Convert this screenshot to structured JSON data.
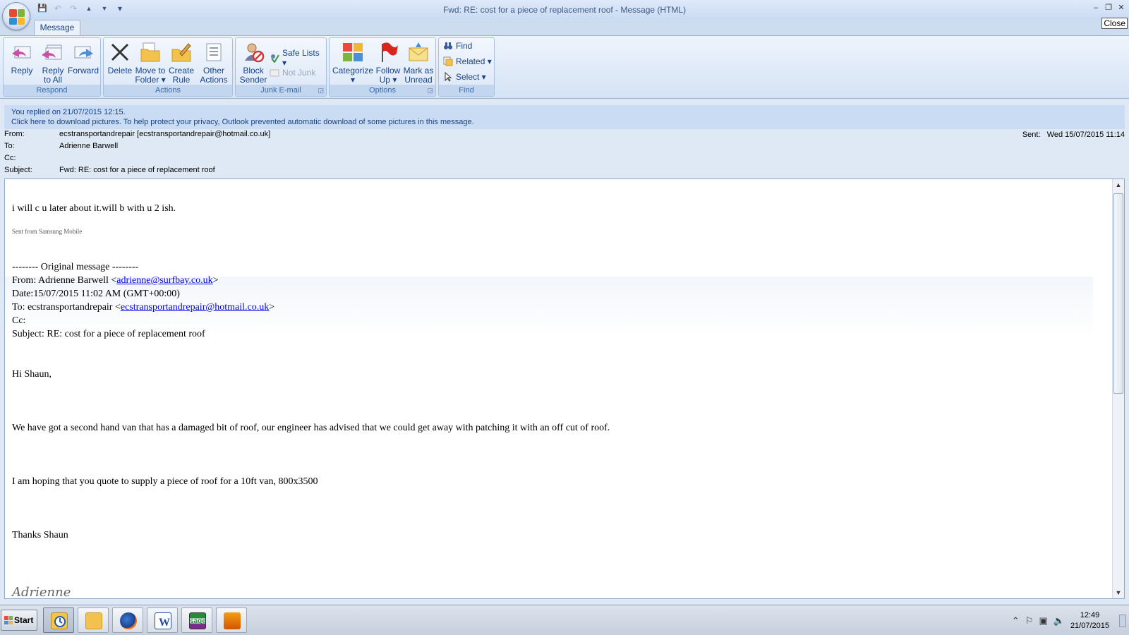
{
  "window": {
    "title": "Fwd: RE: cost for a piece of replacement roof - Message (HTML)",
    "close_tooltip": "Close",
    "controls": {
      "minimize": "–",
      "restore": "❐",
      "close": "✕"
    }
  },
  "qat": {
    "save": "💾",
    "undo": "↶",
    "redo": "↷",
    "up": "▲",
    "down": "▼",
    "customize": "▾"
  },
  "tabs": [
    {
      "label": "Message"
    }
  ],
  "ribbon": {
    "respond": {
      "label": "Respond",
      "reply": "Reply",
      "reply_all_1": "Reply",
      "reply_all_2": "to All",
      "forward": "Forward"
    },
    "actions": {
      "label": "Actions",
      "delete": "Delete",
      "move_1": "Move to",
      "move_2": "Folder ▾",
      "rule_1": "Create",
      "rule_2": "Rule",
      "other_1": "Other",
      "other_2": "Actions ▾"
    },
    "junk": {
      "label": "Junk E-mail",
      "block_1": "Block",
      "block_2": "Sender",
      "safe_lists": "Safe Lists ▾",
      "not_junk": "Not Junk"
    },
    "options": {
      "label": "Options",
      "categorize": "Categorize",
      "categorize_2": "▾",
      "follow_1": "Follow",
      "follow_2": "Up ▾",
      "mark_1": "Mark as",
      "mark_2": "Unread"
    },
    "find": {
      "label": "Find",
      "find": "Find",
      "related": "Related ▾",
      "select": "Select ▾"
    }
  },
  "infobar": {
    "line1": "You replied on 21/07/2015 12:15.",
    "line2": "Click here to download pictures. To help protect your privacy, Outlook prevented automatic download of some pictures in this message."
  },
  "header": {
    "from_label": "From:",
    "from_value": "ecstransportandrepair [ecstransportandrepair@hotmail.co.uk]",
    "to_label": "To:",
    "to_value": "Adrienne Barwell",
    "cc_label": "Cc:",
    "cc_value": "",
    "subject_label": "Subject:",
    "subject_value": "Fwd: RE: cost for a piece of replacement roof",
    "sent_label": "Sent:",
    "sent_value": "Wed 15/07/2015 11:14"
  },
  "body": {
    "line1": "i will c u later about it.will b with u 2 ish.",
    "sent_from": "Sent from Samsung Mobile",
    "original": "-------- Original message --------",
    "from_prefix": "From: Adrienne Barwell <",
    "from_email": "adrienne@surfbay.co.uk",
    "from_suffix": ">",
    "date": "Date:15/07/2015 11:02 AM (GMT+00:00)",
    "to_prefix": "To: ecstransportandrepair <",
    "to_email": "ecstransportandrepair@hotmail.co.uk",
    "to_suffix": ">",
    "cc": "Cc:",
    "subject": "Subject: RE: cost for a piece of replacement roof",
    "greeting": "Hi Shaun,",
    "para1": "We have got a second hand van that has a damaged bit of roof, our engineer has advised that we could get away with patching it with an off cut of roof.",
    "para2": "I am hoping that you quote to supply a piece of roof for a 10ft van, 800x3500",
    "thanks": "Thanks Shaun",
    "signature": "Adrienne"
  },
  "taskbar": {
    "start": "Start",
    "time": "12:49",
    "date": "21/07/2015",
    "app_sage": "sage"
  }
}
